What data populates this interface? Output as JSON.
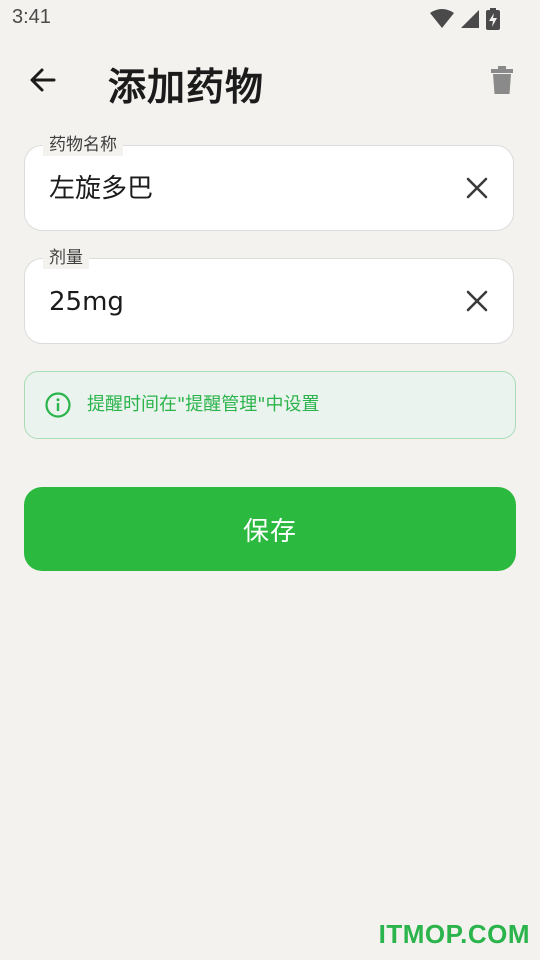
{
  "status_bar": {
    "time": "3:41",
    "icons": [
      "wifi-icon",
      "cell-signal-icon",
      "battery-charging-icon"
    ]
  },
  "header": {
    "title": "添加药物",
    "back_icon": "arrow-left-icon",
    "delete_icon": "trash-icon"
  },
  "form": {
    "name_field": {
      "label": "药物名称",
      "value": "左旋多巴"
    },
    "dose_field": {
      "label": "剂量",
      "value": "25mg"
    }
  },
  "info": {
    "text": "提醒时间在\"提醒管理\"中设置",
    "icon": "info-icon"
  },
  "actions": {
    "save_label": "保存"
  },
  "colors": {
    "accent": "#2bba3f",
    "info_text": "#2bb44b",
    "background": "#f4f2ef"
  },
  "watermark": "ITMOP.COM"
}
